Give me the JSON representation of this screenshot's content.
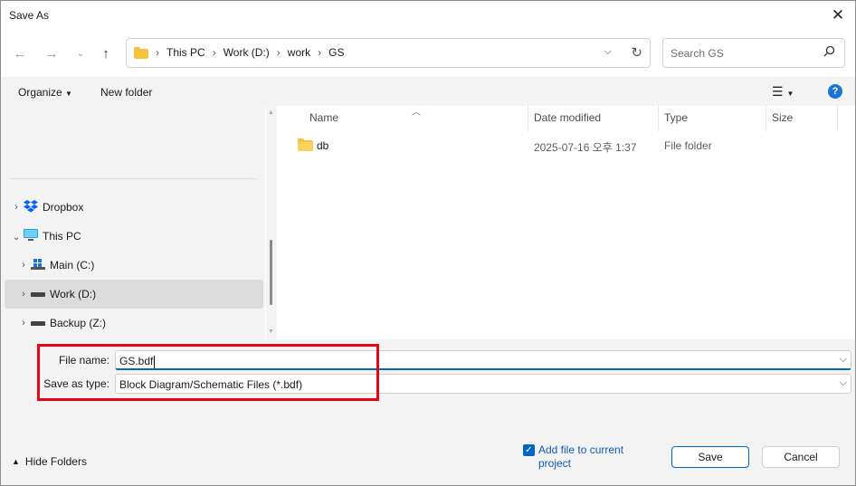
{
  "window": {
    "title": "Save As"
  },
  "nav": {
    "breadcrumbs": [
      "This PC",
      "Work (D:)",
      "work",
      "GS"
    ],
    "search_placeholder": "Search GS"
  },
  "commandbar": {
    "organize": "Organize",
    "new_folder": "New folder",
    "help": "?"
  },
  "tree": {
    "items": [
      {
        "label": "Dropbox",
        "icon": "dropbox-icon"
      },
      {
        "label": "This PC",
        "icon": "computer-icon"
      },
      {
        "label": "Main (C:)",
        "icon": "windows-drive-icon"
      },
      {
        "label": "Work (D:)",
        "icon": "drive-icon",
        "selected": true
      },
      {
        "label": "Backup (Z:)",
        "icon": "drive-icon"
      }
    ]
  },
  "list": {
    "columns": [
      "Name",
      "Date modified",
      "Type",
      "Size"
    ],
    "rows": [
      {
        "name": "db",
        "date": "2025-07-16 오후 1:37",
        "type": "File folder",
        "size": ""
      }
    ]
  },
  "form": {
    "filename_label": "File name:",
    "filename_value": "GS.bdf",
    "type_label": "Save as type:",
    "type_value": "Block Diagram/Schematic Files (*.bdf)"
  },
  "footer": {
    "hide_folders": "Hide Folders",
    "add_file": "Add file to current project",
    "save": "Save",
    "cancel": "Cancel"
  },
  "colors": {
    "accent": "#0067c0",
    "highlight": "#e30613",
    "folder": "#f5c242"
  }
}
